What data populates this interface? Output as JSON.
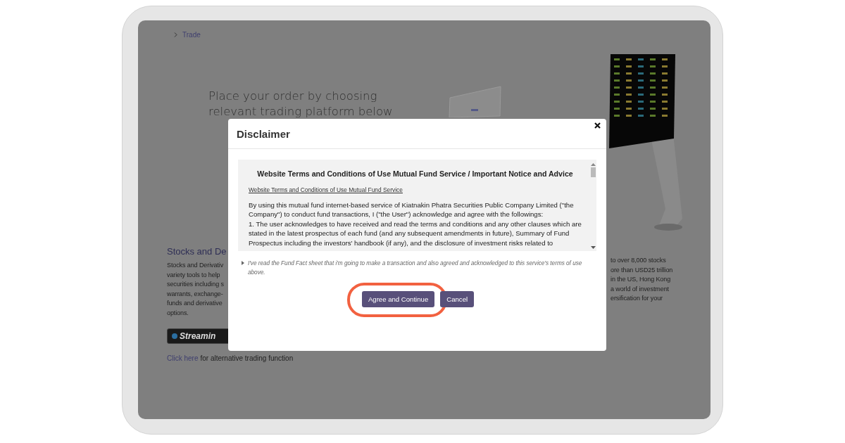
{
  "breadcrumb": [
    {
      "label": "Trade"
    }
  ],
  "hero": {
    "headline_lines": [
      "Place your order by choosing",
      "relevant trading platform below"
    ]
  },
  "sections": [
    {
      "title": "Stocks and De",
      "lines": [
        "Stocks and Derivativ",
        "variety tools to help",
        "securities including s",
        "warrants, exchange-",
        "funds and derivative",
        "options."
      ],
      "logo_text": "Streamin"
    },
    {
      "lines": [
        "to over 8,000 stocks",
        "ore than USD25 trillion",
        "in the US, Hong Kong",
        "a world of investment",
        "ersification for your"
      ]
    }
  ],
  "alternative": {
    "link": "Click here",
    "text": "for alternative trading function"
  },
  "modal": {
    "title": "Disclaimer",
    "document": {
      "title": "Website Terms and Conditions of Use Mutual Fund Service / Important Notice and Advice",
      "link": "Website Terms and Conditions of Use Mutual Fund Service",
      "paragraphs": [
        "By using this mutual fund internet-based service of Kiatnakin Phatra Securities Public Company Limited (\"the Company\") to conduct fund transactions, I (\"the User\") acknowledge and agree with the followings:",
        "1. The user acknowledges to have received and read the terms and conditions and any other clauses which are stated in the latest prospectus of each fund (and any subsequent amendments in future), Summary of Fund Prospectus including the investors' handbook (if any), and the disclosure of investment risks related to"
      ]
    },
    "note": "I've read the Fund Fact sheet that i'm going to make a transaction and also agreed and acknowledged to this service's terms of use above.",
    "buttons": [
      {
        "label": "Agree and Continue",
        "highlighted": true
      },
      {
        "label": "Cancel",
        "highlighted": false
      }
    ]
  }
}
